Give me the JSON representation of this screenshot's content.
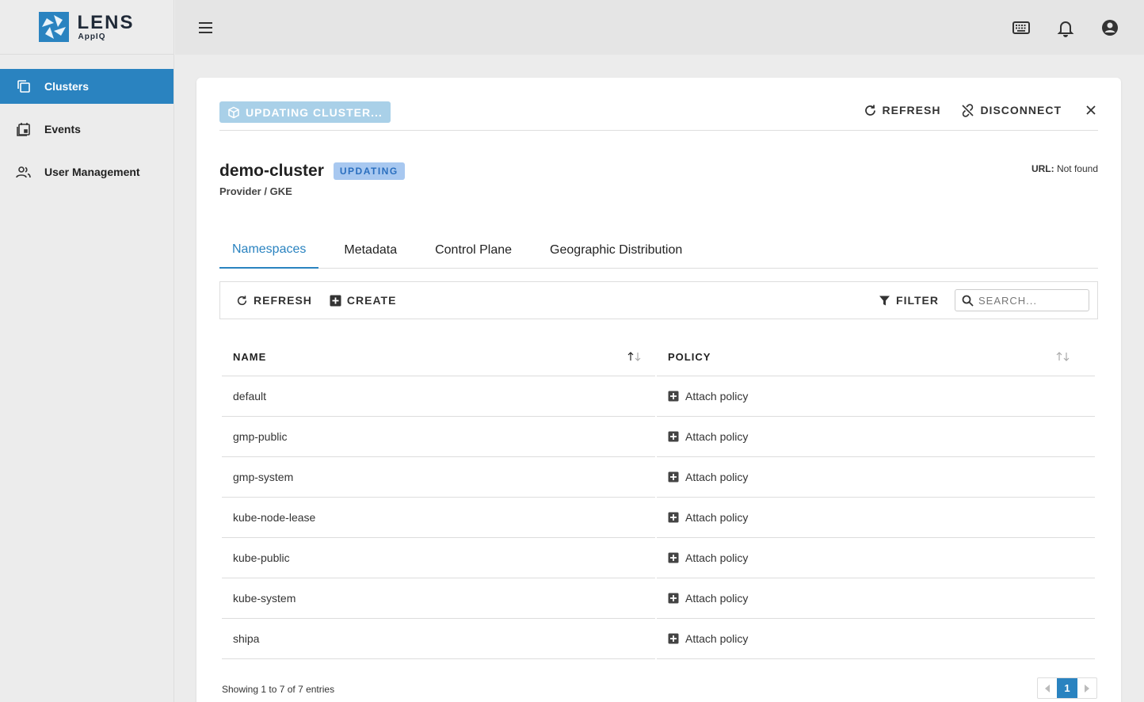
{
  "app": {
    "logo_main": "LENS",
    "logo_sub": "AppIQ"
  },
  "sidebar": {
    "items": [
      {
        "label": "Clusters",
        "icon": "clusters-icon",
        "active": true
      },
      {
        "label": "Events",
        "icon": "calendar-icon",
        "active": false
      },
      {
        "label": "User Management",
        "icon": "users-icon",
        "active": false
      }
    ]
  },
  "topbar": {
    "icons": [
      "keyboard-icon",
      "bell-icon",
      "account-circle-icon"
    ]
  },
  "header": {
    "status_label": "UPDATING CLUSTER...",
    "refresh_label": "REFRESH",
    "disconnect_label": "DISCONNECT"
  },
  "cluster": {
    "name": "demo-cluster",
    "badge": "UPDATING",
    "provider": "Provider / GKE",
    "url_label": "URL:",
    "url_value": "Not found"
  },
  "tabs": [
    {
      "label": "Namespaces",
      "active": true
    },
    {
      "label": "Metadata",
      "active": false
    },
    {
      "label": "Control Plane",
      "active": false
    },
    {
      "label": "Geographic Distribution",
      "active": false
    }
  ],
  "toolbar": {
    "refresh_label": "REFRESH",
    "create_label": "CREATE",
    "filter_label": "FILTER",
    "search_placeholder": "SEARCH..."
  },
  "table": {
    "columns": [
      "NAME",
      "POLICY"
    ],
    "action_label": "Attach policy",
    "rows": [
      "default",
      "gmp-public",
      "gmp-system",
      "kube-node-lease",
      "kube-public",
      "kube-system",
      "shipa"
    ]
  },
  "footer": {
    "info": "Showing 1 to 7 of 7 entries",
    "current_page": "1"
  },
  "colors": {
    "accent": "#2a83c0",
    "status_button": "#a9d0e8",
    "badge_bg": "#a8c8f0"
  }
}
